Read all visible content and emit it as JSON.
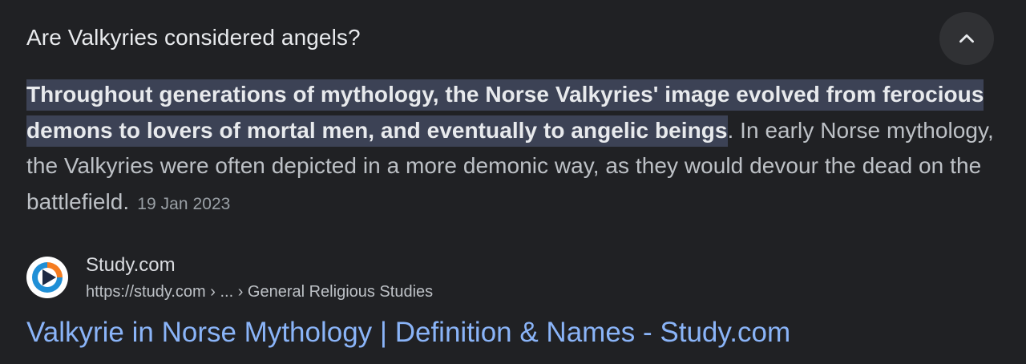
{
  "question": "Are Valkyries considered angels?",
  "collapse_button": {
    "icon": "chevron-up-icon"
  },
  "answer": {
    "highlighted": "Throughout generations of mythology, the Norse Valkyries' image evolved from ferocious demons to lovers of mortal men, and eventually to angelic beings",
    "rest": ". In early Norse mythology, the Valkyries were often depicted in a more demonic way, as they would devour the dead on the battlefield.",
    "date": "19 Jan 2023"
  },
  "source": {
    "favicon": "study-com-play-icon",
    "name": "Study.com",
    "url": "https://study.com › ... › General Religious Studies"
  },
  "result": {
    "title": "Valkyrie in Norse Mythology | Definition & Names - Study.com"
  },
  "colors": {
    "background": "#202124",
    "highlight": "#3c4255",
    "link": "#8ab4f8",
    "favicon_orange": "#f57c20",
    "favicon_blue": "#1f8fd6",
    "favicon_dark": "#1d2a44"
  }
}
